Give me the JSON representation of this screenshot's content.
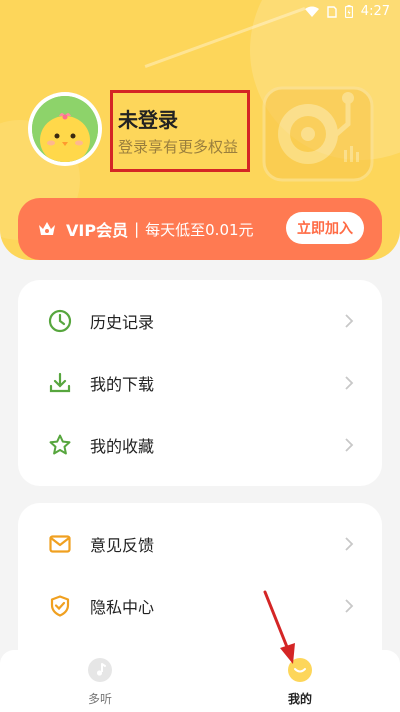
{
  "status_bar": {
    "time": "4:27"
  },
  "user": {
    "name": "未登录",
    "subtitle": "登录享有更多权益"
  },
  "vip": {
    "title": "VIP会员",
    "separator": "|",
    "description": "每天低至0.01元",
    "join_button": "立即加入"
  },
  "menu_group1": [
    {
      "label": "历史记录",
      "icon": "clock-icon"
    },
    {
      "label": "我的下载",
      "icon": "download-icon"
    },
    {
      "label": "我的收藏",
      "icon": "star-icon"
    }
  ],
  "menu_group2": [
    {
      "label": "意见反馈",
      "icon": "mail-icon"
    },
    {
      "label": "隐私中心",
      "icon": "shield-icon"
    }
  ],
  "tabs": [
    {
      "label": "多听",
      "icon": "music-note-icon",
      "active": false
    },
    {
      "label": "我的",
      "icon": "profile-icon",
      "active": true
    }
  ],
  "colors": {
    "header_yellow": "#fdd65a",
    "vip_orange": "#ff7a52",
    "icon_green": "#57a63e",
    "icon_orange": "#f0a020",
    "highlight_red": "#d42525"
  }
}
